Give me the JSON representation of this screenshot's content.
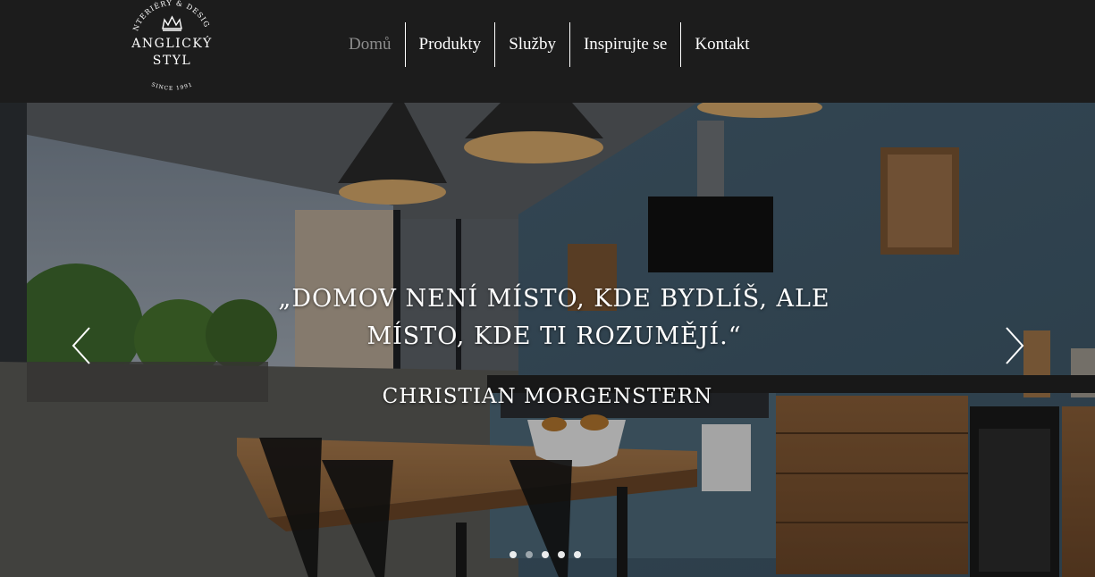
{
  "logo": {
    "arc_text": "INTERIÉRY & DESIGN",
    "line1": "ANGLICKÝ",
    "line2": "STYL",
    "since": "SINCE 1991"
  },
  "nav": {
    "items": [
      {
        "label": "Domů",
        "active": true
      },
      {
        "label": "Produkty",
        "active": false
      },
      {
        "label": "Služby",
        "active": false
      },
      {
        "label": "Inspirujte se",
        "active": false
      },
      {
        "label": "Kontakt",
        "active": false
      }
    ]
  },
  "hero": {
    "quote_line1": "„DOMOV NENÍ MÍSTO, KDE BYDLÍŠ, ALE",
    "quote_line2": "MÍSTO, KDE TI ROZUMĚJÍ.“",
    "author": "CHRISTIAN MORGENSTERN",
    "slides_count": 5,
    "active_slide": 1
  },
  "colors": {
    "header_bg": "#1c1c1c",
    "nav_active": "#8d8d8d",
    "nav_text": "#ffffff"
  }
}
